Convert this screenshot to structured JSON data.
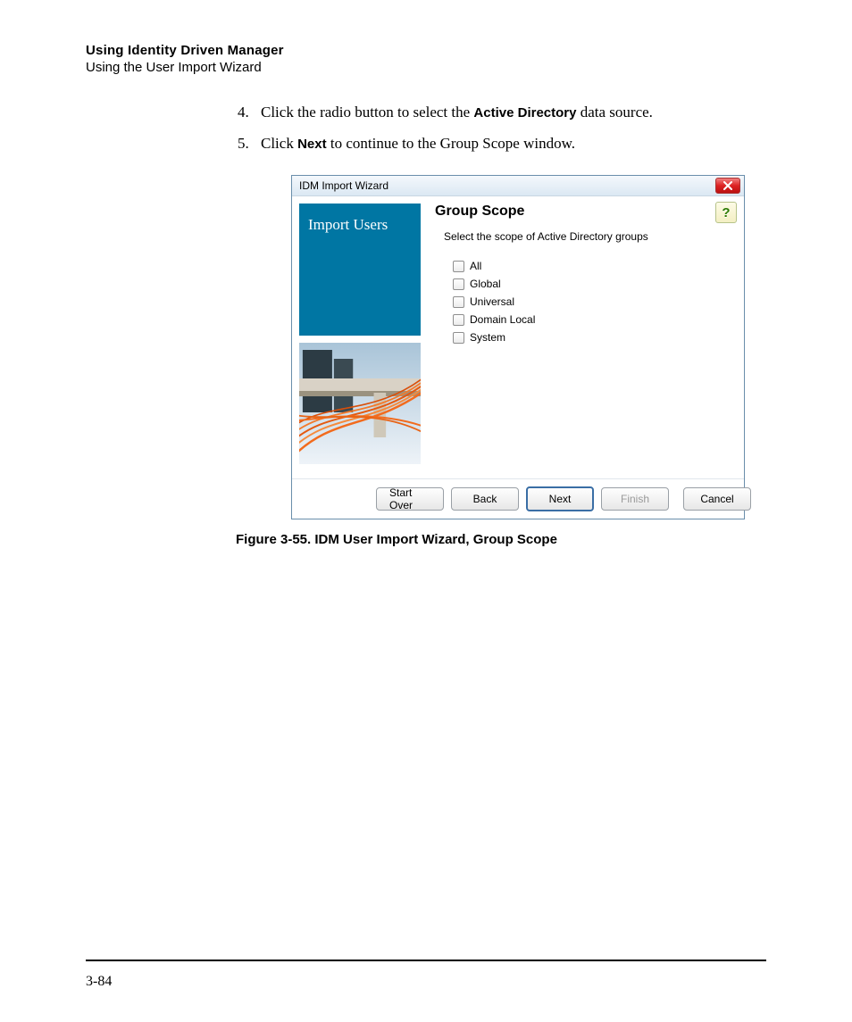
{
  "header": {
    "title": "Using Identity Driven Manager",
    "subtitle": "Using the User Import Wizard"
  },
  "steps": [
    {
      "num": "4.",
      "pre": "Click the radio button to select the ",
      "bold": "Active Directory",
      "post": " data source."
    },
    {
      "num": "5.",
      "pre": "Click ",
      "bold": "Next",
      "post": " to continue to the Group Scope window."
    }
  ],
  "wizard": {
    "title": "IDM Import Wizard",
    "side_label": "Import Users",
    "group_title": "Group Scope",
    "group_desc": "Select the scope of Active Directory groups",
    "help_glyph": "?",
    "options": [
      "All",
      "Global",
      "Universal",
      "Domain Local",
      "System"
    ],
    "buttons": {
      "start_over": "Start Over",
      "back": "Back",
      "next": "Next",
      "finish": "Finish",
      "cancel": "Cancel"
    }
  },
  "caption": "Figure 3-55. IDM User Import Wizard, Group Scope",
  "page_number": "3-84"
}
